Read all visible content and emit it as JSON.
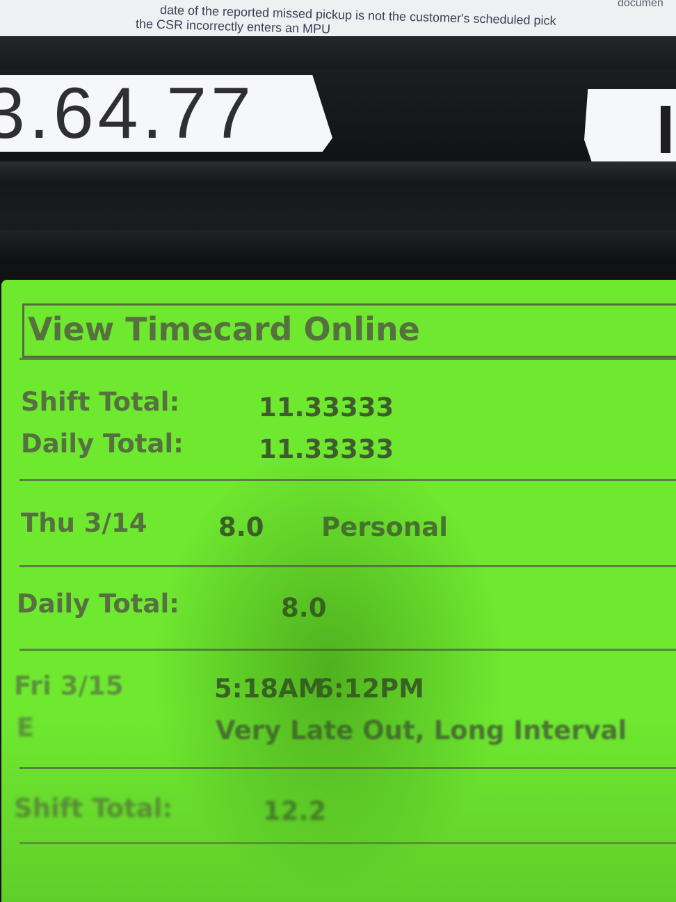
{
  "paper": {
    "line1": "date of the reported missed pickup is not the customer's scheduled pick",
    "line2": "the CSR incorrectly enters an MPU",
    "corner_fragment": "documen"
  },
  "labels": {
    "left_text": "3.64.77",
    "right_text": ""
  },
  "timecard": {
    "title": "View Timecard Online",
    "summary": {
      "shift_total_label": "Shift Total:",
      "shift_total_value": "11.33333",
      "daily_total_label": "Daily Total:",
      "daily_total_value": "11.33333"
    },
    "entry_thu": {
      "day": "Thu 3/14",
      "hours": "8.0",
      "type": "Personal"
    },
    "daily_total": {
      "label": "Daily Total:",
      "value": "8.0"
    },
    "entry_fri": {
      "day": "Fri 3/15",
      "code": "E",
      "time_in": "5:18AM",
      "time_out": "6:12PM",
      "exception": "Very Late Out, Long Interval"
    },
    "shift_total": {
      "label": "Shift Total:",
      "value": "12.2"
    }
  }
}
